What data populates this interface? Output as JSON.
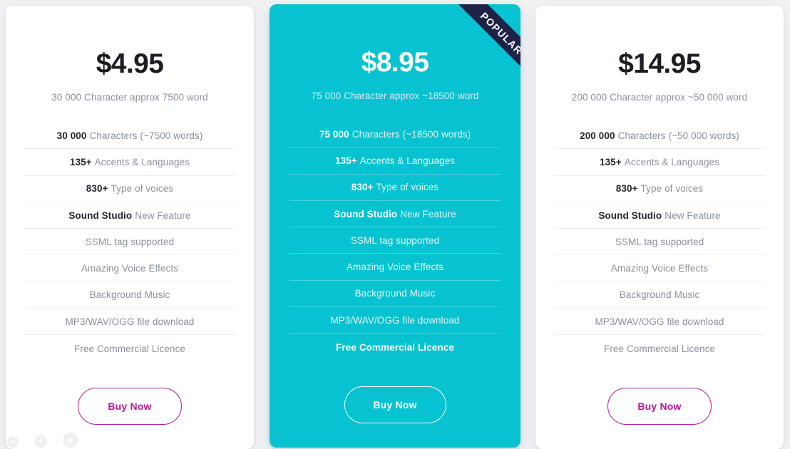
{
  "theme": {
    "page_background": "#f0f1f3",
    "featured_background": "#07c2d0",
    "ribbon_background": "#1e2247",
    "accent_button": "#b5199e",
    "price_color": "#1a1d21",
    "muted_text": "#8a9099"
  },
  "plans": [
    {
      "id": "starter",
      "price": "$4.95",
      "subtitle": "30 000 Character approx 7500 word",
      "featured": false,
      "badge": null,
      "features": [
        {
          "strong": "30 000",
          "text": "Characters (~7500 words)"
        },
        {
          "strong": "135+",
          "text": "Accents & Languages"
        },
        {
          "strong": "830+",
          "text": "Type of voices"
        },
        {
          "strong": "Sound Studio",
          "text": "New Feature"
        },
        {
          "strong": "",
          "text": "SSML tag supported"
        },
        {
          "strong": "",
          "text": "Amazing Voice Effects"
        },
        {
          "strong": "",
          "text": "Background Music"
        },
        {
          "strong": "",
          "text": "MP3/WAV/OGG file download"
        },
        {
          "strong": "",
          "text": "Free Commercial Licence"
        }
      ],
      "cta": "Buy Now"
    },
    {
      "id": "popular",
      "price": "$8.95",
      "subtitle": "75 000 Character approx ~18500 word",
      "featured": true,
      "badge": "POPULAR",
      "features": [
        {
          "strong": "75 000",
          "text": "Characters (~18500 words)"
        },
        {
          "strong": "135+",
          "text": "Accents & Languages"
        },
        {
          "strong": "830+",
          "text": "Type of voices"
        },
        {
          "strong": "Sound Studio",
          "text": "New Feature"
        },
        {
          "strong": "",
          "text": "SSML tag supported"
        },
        {
          "strong": "",
          "text": "Amazing Voice Effects"
        },
        {
          "strong": "",
          "text": "Background Music"
        },
        {
          "strong": "",
          "text": "MP3/WAV/OGG file download"
        },
        {
          "strong": "",
          "text": "Free Commercial Licence"
        }
      ],
      "cta": "Buy Now"
    },
    {
      "id": "pro",
      "price": "$14.95",
      "subtitle": "200 000 Character approx ~50 000 word",
      "featured": false,
      "badge": null,
      "features": [
        {
          "strong": "200 000",
          "text": "Characters (~50 000 words)"
        },
        {
          "strong": "135+",
          "text": "Accents & Languages"
        },
        {
          "strong": "830+",
          "text": "Type of voices"
        },
        {
          "strong": "Sound Studio",
          "text": "New Feature"
        },
        {
          "strong": "",
          "text": "SSML tag supported"
        },
        {
          "strong": "",
          "text": "Amazing Voice Effects"
        },
        {
          "strong": "",
          "text": "Background Music"
        },
        {
          "strong": "",
          "text": "MP3/WAV/OGG file download"
        },
        {
          "strong": "",
          "text": "Free Commercial Licence"
        }
      ],
      "cta": "Buy Now"
    }
  ],
  "widget_dots": [
    {
      "icon": "accessibility-dot-icon",
      "size": "s"
    },
    {
      "icon": "accessibility-dot-icon",
      "size": "m"
    },
    {
      "icon": "accessibility-square-dot-icon",
      "size": "l"
    }
  ]
}
